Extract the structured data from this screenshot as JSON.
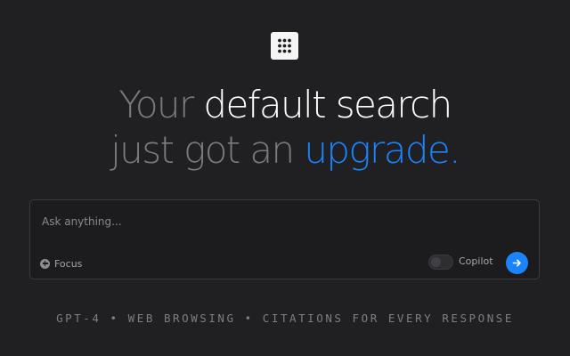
{
  "logo": {
    "icon": "grid-dots-icon"
  },
  "headline": {
    "line1_dim": "Your",
    "line1_bright": "default search",
    "line2_dim": "just got an",
    "line2_accent": "upgrade."
  },
  "search": {
    "placeholder": "Ask anything...",
    "value": "",
    "focus_label": "Focus",
    "copilot_label": "Copilot",
    "copilot_enabled": false
  },
  "tagline": "GPT-4 • WEB BROWSING • CITATIONS FOR EVERY RESPONSE",
  "colors": {
    "background": "#202023",
    "accent": "#1a84ff",
    "text_bright": "#ffffff",
    "text_dim": "#7b7b7f"
  }
}
